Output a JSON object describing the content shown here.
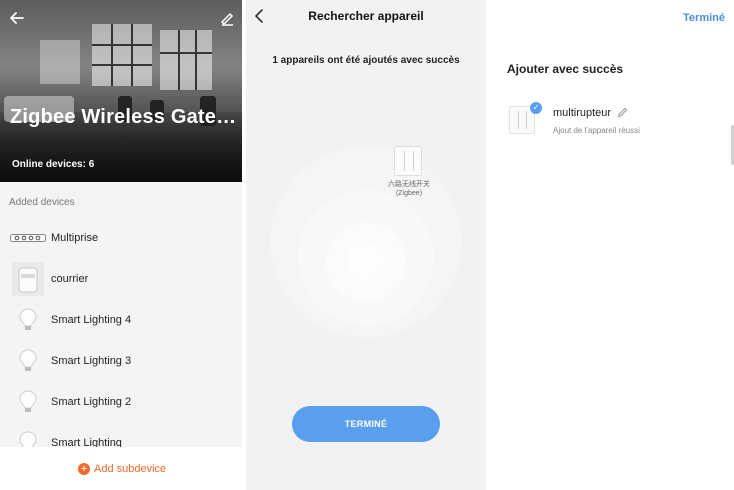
{
  "panel1": {
    "title": "Zigbee Wireless Gatew...",
    "online_devices": "Online devices: 6",
    "section_label": "Added devices",
    "devices": [
      {
        "label": "Multiprise",
        "icon": "power-strip-icon"
      },
      {
        "label": "courrier",
        "icon": "mailbox-sensor-icon"
      },
      {
        "label": "Smart Lighting 4",
        "icon": "bulb-icon"
      },
      {
        "label": "Smart Lighting 3",
        "icon": "bulb-icon"
      },
      {
        "label": "Smart Lighting 2",
        "icon": "bulb-icon"
      },
      {
        "label": "Smart Lighting",
        "icon": "bulb-icon"
      }
    ],
    "add_subdevice": "Add subdevice",
    "accent_color": "#f26b2a"
  },
  "panel2": {
    "title": "Rechercher appareil",
    "message": "1 appareils ont été ajoutés avec succès",
    "found_device_caption_line1": "六路无线开关",
    "found_device_caption_line2": "(Zigbee)",
    "done_button": "TERMINÉ",
    "button_color": "#5a9ef0"
  },
  "panel3": {
    "done_link": "Terminé",
    "title": "Ajouter avec succès",
    "device_name": "multirupteur",
    "device_status": "Ajout de l'appareil réussi",
    "link_color": "#4a8fe2"
  }
}
